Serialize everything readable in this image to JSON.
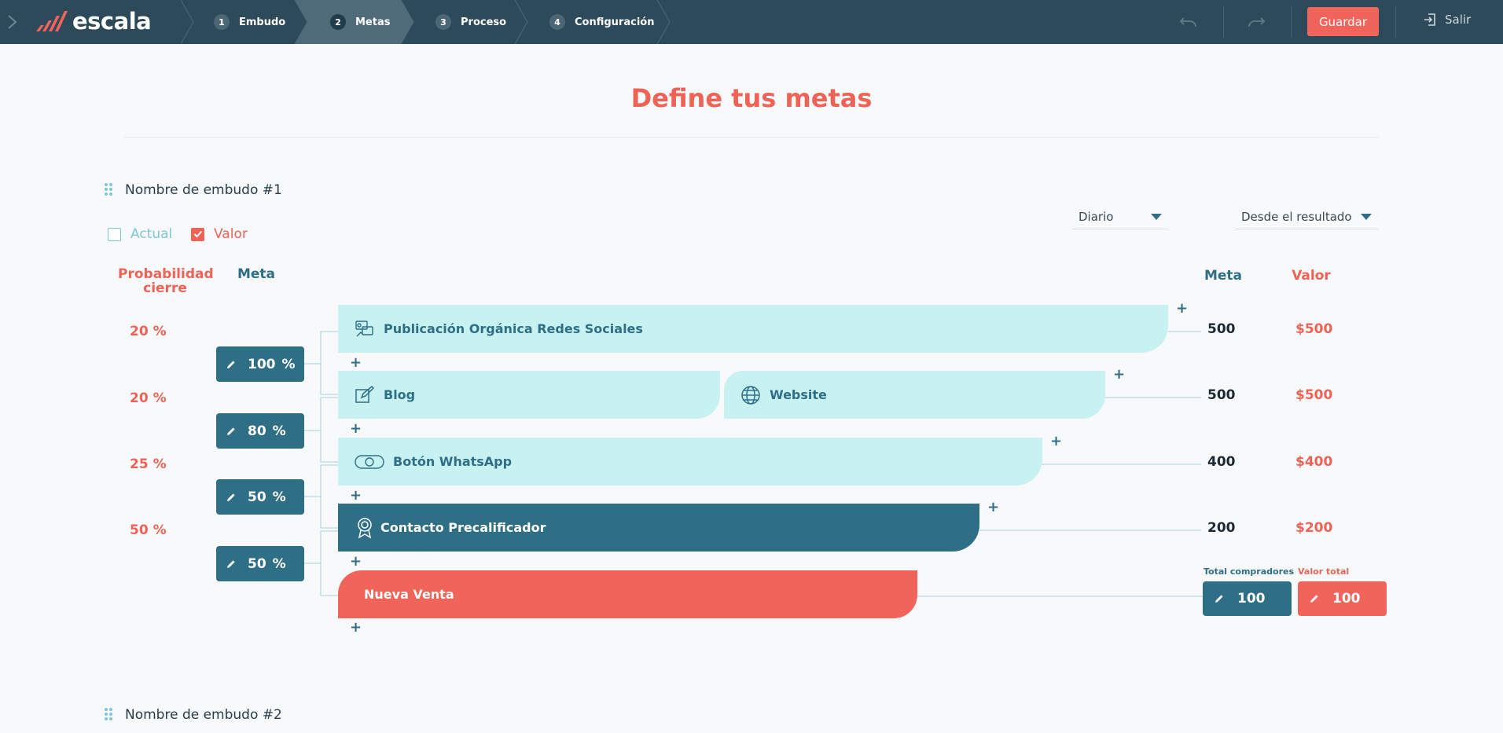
{
  "app": {
    "logo_text": "escala",
    "brand_colors": {
      "primary": "#2c4a5a",
      "accent": "#f0645a",
      "teal": "#2f6f86",
      "light": "#c8f1f2"
    }
  },
  "nav": {
    "steps": [
      {
        "num": "1",
        "label": "Embudo"
      },
      {
        "num": "2",
        "label": "Metas"
      },
      {
        "num": "3",
        "label": "Proceso"
      },
      {
        "num": "4",
        "label": "Configuración"
      }
    ],
    "active_step": "2",
    "save_label": "Guardar",
    "exit_label": "Salir"
  },
  "page": {
    "title": "Define tus metas"
  },
  "funnel1": {
    "name": "Nombre de embudo #1",
    "checkbox_actual": {
      "label": "Actual",
      "checked": false
    },
    "checkbox_valor": {
      "label": "Valor",
      "checked": true
    },
    "period_select": "Diario",
    "mode_select": "Desde el resultado",
    "headers": {
      "probabilidad": "Probabilidad cierre",
      "meta_left": "Meta",
      "meta_right": "Meta",
      "valor": "Valor"
    },
    "probabilities": [
      "20 %",
      "20 %",
      "25 %",
      "50 %"
    ],
    "conversions": [
      {
        "value": "100",
        "unit": "%"
      },
      {
        "value": "80",
        "unit": "%"
      },
      {
        "value": "50",
        "unit": "%"
      },
      {
        "value": "50",
        "unit": "%"
      }
    ],
    "stages": {
      "s1": "Publicación Orgánica Redes Sociales",
      "s2a": "Blog",
      "s2b": "Website",
      "s3": "Botón WhatsApp",
      "s4": "Contacto Precalificador",
      "s5": "Nueva Venta"
    },
    "metas": [
      "500",
      "500",
      "400",
      "200"
    ],
    "valores": [
      "$500",
      "$500",
      "$400",
      "$200"
    ],
    "totals": {
      "buyers_label": "Total compradores",
      "buyers_value": "100",
      "value_label": "Valor total",
      "value_value": "100"
    },
    "plus": "+"
  },
  "funnel2": {
    "name": "Nombre de embudo #2"
  }
}
